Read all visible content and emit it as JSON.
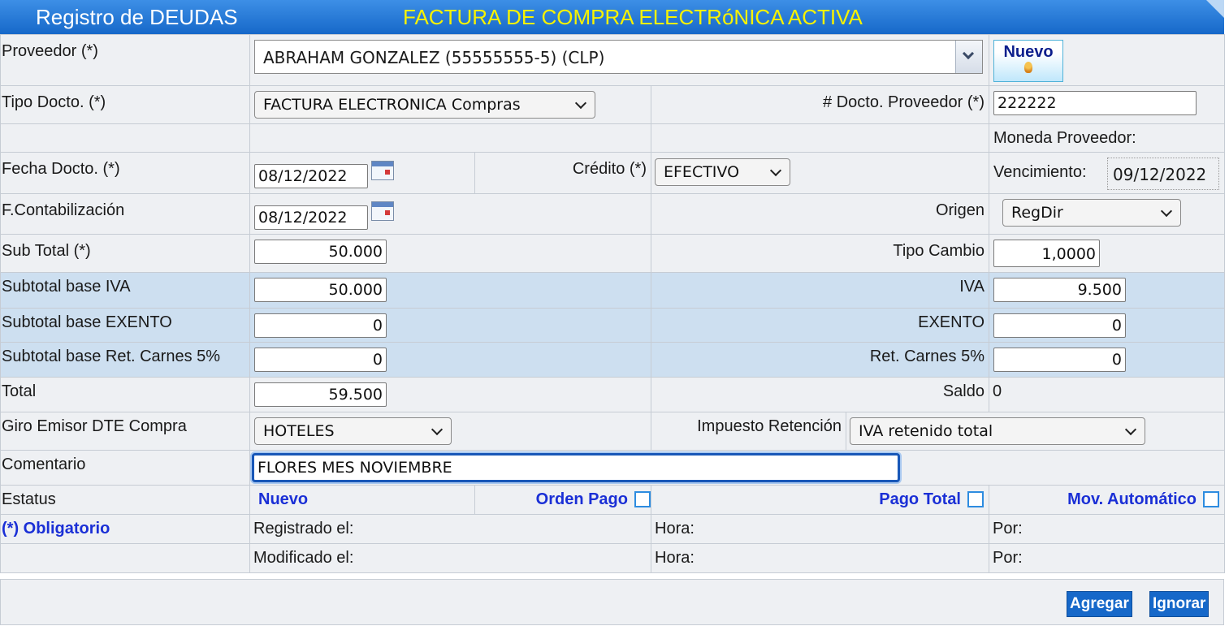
{
  "header": {
    "title": "Registro de DEUDAS",
    "subtitle": "FACTURA DE COMPRA ELECTRóNICA ACTIVA"
  },
  "colors": {
    "title_bg": "#1668c9",
    "subtitle_fg": "#f7f200",
    "row_blue": "#cddff0",
    "link_blue": "#1a2fd6"
  },
  "form": {
    "proveedor_label": "Proveedor (*)",
    "proveedor_value": "ABRAHAM GONZALEZ (55555555-5) (CLP)",
    "nuevo_button": "Nuevo",
    "tipo_docto_label": "Tipo Docto. (*)",
    "tipo_docto_value": "FACTURA ELECTRONICA Compras",
    "docto_proveedor_label": "# Docto. Proveedor (*)",
    "docto_proveedor_value": "222222",
    "moneda_label": "Moneda Proveedor:",
    "fecha_docto_label": "Fecha Docto. (*)",
    "fecha_docto_value": "08/12/2022",
    "credito_label": "Crédito (*)",
    "credito_value": "EFECTIVO",
    "vencimiento_label": "Vencimiento:",
    "vencimiento_value": "09/12/2022",
    "f_contab_label": "F.Contabilización",
    "f_contab_value": "08/12/2022",
    "origen_label": "Origen",
    "origen_value": "RegDir",
    "sub_total_label": "Sub Total (*)",
    "sub_total_value": "50.000",
    "tipo_cambio_label": "Tipo Cambio",
    "tipo_cambio_value": "1,0000",
    "base_iva_label": "Subtotal base IVA",
    "base_iva_value": "50.000",
    "iva_label": "IVA",
    "iva_value": "9.500",
    "base_exento_label": "Subtotal base EXENTO",
    "base_exento_value": "0",
    "exento_label": "EXENTO",
    "exento_value": "0",
    "base_ret_label": "Subtotal base Ret. Carnes 5%",
    "base_ret_value": "0",
    "ret_label": "Ret. Carnes 5%",
    "ret_value": "0",
    "total_label": "Total",
    "total_value": "59.500",
    "saldo_label": "Saldo",
    "saldo_value": "0",
    "giro_label": "Giro Emisor DTE Compra",
    "giro_value": "HOTELES",
    "impuesto_label": "Impuesto Retención",
    "impuesto_value": "IVA retenido total",
    "comentario_label": "Comentario",
    "comentario_value": "FLORES MES NOVIEMBRE",
    "estatus_label": "Estatus",
    "estatus_value": "Nuevo",
    "orden_pago_label": "Orden Pago",
    "pago_total_label": "Pago Total",
    "mov_auto_label": "Mov. Automático",
    "obligatorio_label": "(*) Obligatorio",
    "registrado_label": "Registrado el:",
    "modificado_label": "Modificado el:",
    "hora_label": "Hora:",
    "por_label": "Por:"
  },
  "actions": {
    "agregar": "Agregar",
    "ignorar": "Ignorar"
  }
}
